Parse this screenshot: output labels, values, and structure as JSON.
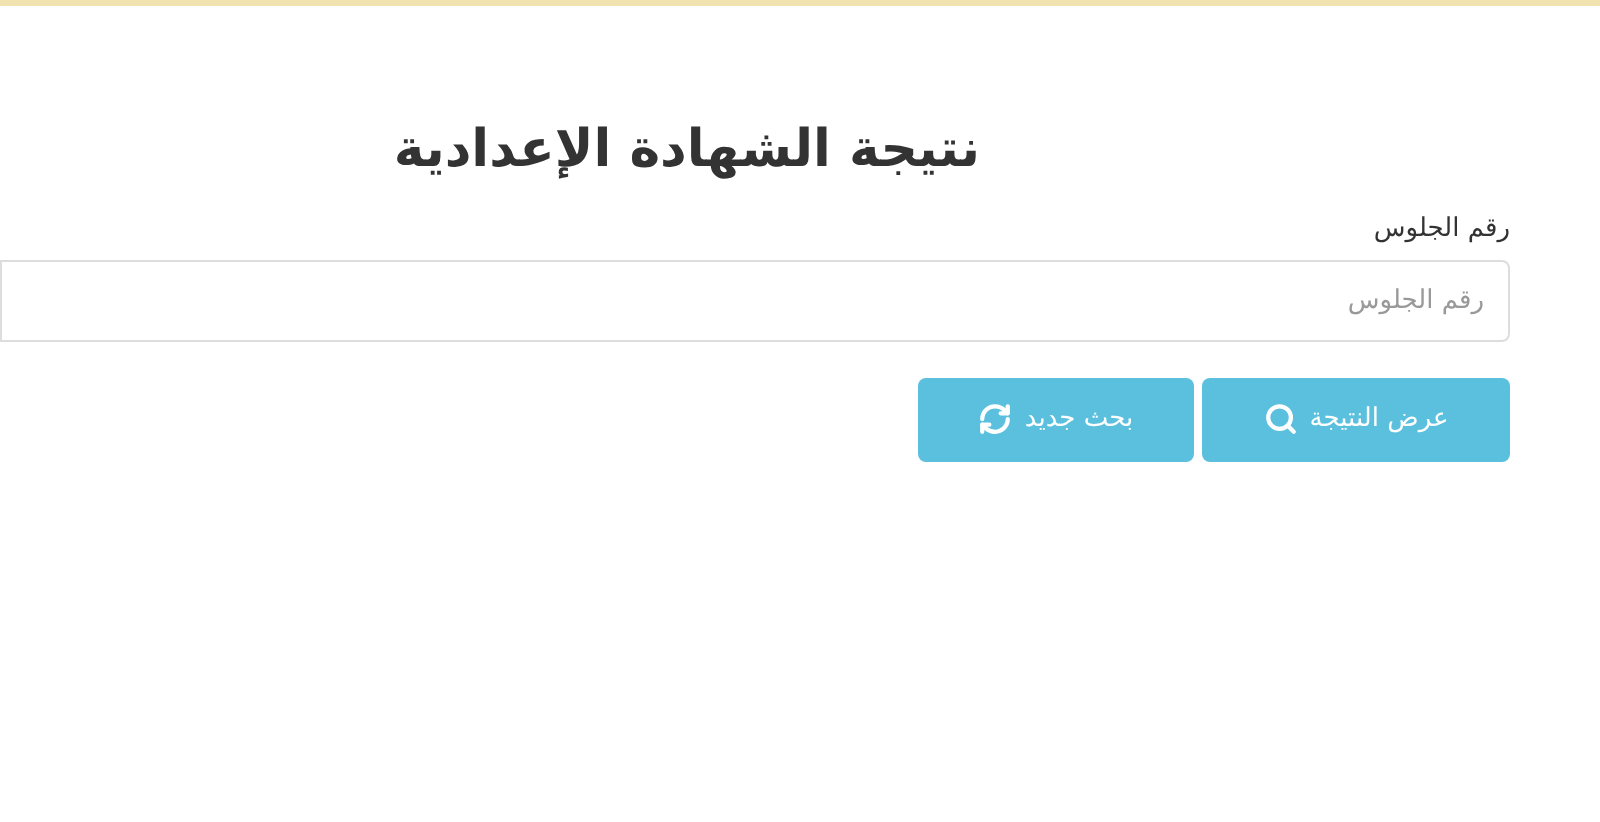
{
  "title": "نتيجة الشهادة الإعدادية",
  "seat_field": {
    "label": "رقم الجلوس",
    "placeholder": "رقم الجلوس"
  },
  "buttons": [
    {
      "label": "عرض النتيجة",
      "kind": "search"
    },
    {
      "label": "بحث جديد",
      "kind": "refresh"
    }
  ]
}
